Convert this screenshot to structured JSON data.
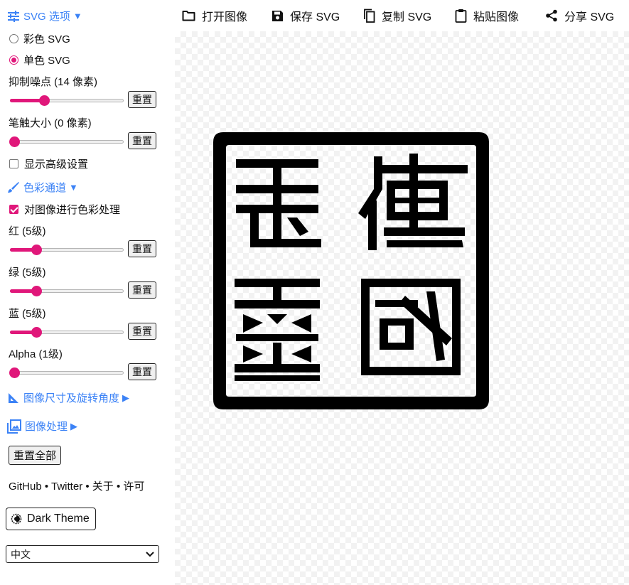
{
  "sidebar": {
    "svg_options": {
      "title": "SVG 选项",
      "caret": "▼"
    },
    "color_mode": {
      "options": [
        {
          "label": "彩色 SVG",
          "selected": false
        },
        {
          "label": "单色 SVG",
          "selected": true
        }
      ]
    },
    "suppress_speckles": {
      "label": "抑制噪点 (14 像素)",
      "value": 14,
      "fraction": 0.3,
      "reset": "重置"
    },
    "stroke_size": {
      "label": "笔触大小 (0 像素)",
      "value": 0,
      "fraction": 0.04,
      "reset": "重置"
    },
    "advanced": {
      "label": "显示高级设置",
      "checked": false
    },
    "color_channels": {
      "title": "色彩通道",
      "caret": "▼",
      "process_colors": {
        "label": "对图像进行色彩处理",
        "checked": true
      },
      "red": {
        "label": "红 (5级)",
        "value": 5,
        "fraction": 0.23,
        "reset": "重置"
      },
      "green": {
        "label": "绿 (5级)",
        "value": 5,
        "fraction": 0.23,
        "reset": "重置"
      },
      "blue": {
        "label": "蓝 (5级)",
        "value": 5,
        "fraction": 0.23,
        "reset": "重置"
      },
      "alpha": {
        "label": "Alpha (1级)",
        "value": 1,
        "fraction": 0.04,
        "reset": "重置"
      }
    },
    "size_rotation": {
      "title": "图像尺寸及旋转角度",
      "caret": "▶"
    },
    "image_processing": {
      "title": "图像处理",
      "caret": "▶"
    },
    "reset_all": "重置全部",
    "links": {
      "github": "GitHub",
      "twitter": "Twitter",
      "about": "关于",
      "license": "许可",
      "sep": " • "
    },
    "theme_button": "Dark Theme",
    "language": {
      "selected": "中文"
    }
  },
  "toolbar": {
    "open": "打开图像",
    "save": "保存 SVG",
    "copy": "复制 SVG",
    "paste": "粘贴图像",
    "share": "分享 SVG"
  },
  "colors": {
    "accent": "#e0177a",
    "link": "#3b82f6",
    "seal": "#000000"
  }
}
